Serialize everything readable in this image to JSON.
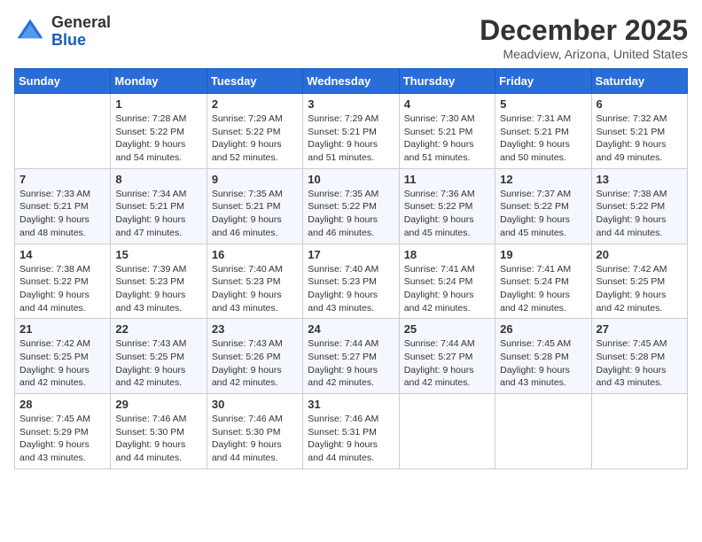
{
  "header": {
    "logo_general": "General",
    "logo_blue": "Blue",
    "month_year": "December 2025",
    "location": "Meadview, Arizona, United States"
  },
  "days_of_week": [
    "Sunday",
    "Monday",
    "Tuesday",
    "Wednesday",
    "Thursday",
    "Friday",
    "Saturday"
  ],
  "weeks": [
    [
      {
        "day": "",
        "info": ""
      },
      {
        "day": "1",
        "info": "Sunrise: 7:28 AM\nSunset: 5:22 PM\nDaylight: 9 hours\nand 54 minutes."
      },
      {
        "day": "2",
        "info": "Sunrise: 7:29 AM\nSunset: 5:22 PM\nDaylight: 9 hours\nand 52 minutes."
      },
      {
        "day": "3",
        "info": "Sunrise: 7:29 AM\nSunset: 5:21 PM\nDaylight: 9 hours\nand 51 minutes."
      },
      {
        "day": "4",
        "info": "Sunrise: 7:30 AM\nSunset: 5:21 PM\nDaylight: 9 hours\nand 51 minutes."
      },
      {
        "day": "5",
        "info": "Sunrise: 7:31 AM\nSunset: 5:21 PM\nDaylight: 9 hours\nand 50 minutes."
      },
      {
        "day": "6",
        "info": "Sunrise: 7:32 AM\nSunset: 5:21 PM\nDaylight: 9 hours\nand 49 minutes."
      }
    ],
    [
      {
        "day": "7",
        "info": "Sunrise: 7:33 AM\nSunset: 5:21 PM\nDaylight: 9 hours\nand 48 minutes."
      },
      {
        "day": "8",
        "info": "Sunrise: 7:34 AM\nSunset: 5:21 PM\nDaylight: 9 hours\nand 47 minutes."
      },
      {
        "day": "9",
        "info": "Sunrise: 7:35 AM\nSunset: 5:21 PM\nDaylight: 9 hours\nand 46 minutes."
      },
      {
        "day": "10",
        "info": "Sunrise: 7:35 AM\nSunset: 5:22 PM\nDaylight: 9 hours\nand 46 minutes."
      },
      {
        "day": "11",
        "info": "Sunrise: 7:36 AM\nSunset: 5:22 PM\nDaylight: 9 hours\nand 45 minutes."
      },
      {
        "day": "12",
        "info": "Sunrise: 7:37 AM\nSunset: 5:22 PM\nDaylight: 9 hours\nand 45 minutes."
      },
      {
        "day": "13",
        "info": "Sunrise: 7:38 AM\nSunset: 5:22 PM\nDaylight: 9 hours\nand 44 minutes."
      }
    ],
    [
      {
        "day": "14",
        "info": "Sunrise: 7:38 AM\nSunset: 5:22 PM\nDaylight: 9 hours\nand 44 minutes."
      },
      {
        "day": "15",
        "info": "Sunrise: 7:39 AM\nSunset: 5:23 PM\nDaylight: 9 hours\nand 43 minutes."
      },
      {
        "day": "16",
        "info": "Sunrise: 7:40 AM\nSunset: 5:23 PM\nDaylight: 9 hours\nand 43 minutes."
      },
      {
        "day": "17",
        "info": "Sunrise: 7:40 AM\nSunset: 5:23 PM\nDaylight: 9 hours\nand 43 minutes."
      },
      {
        "day": "18",
        "info": "Sunrise: 7:41 AM\nSunset: 5:24 PM\nDaylight: 9 hours\nand 42 minutes."
      },
      {
        "day": "19",
        "info": "Sunrise: 7:41 AM\nSunset: 5:24 PM\nDaylight: 9 hours\nand 42 minutes."
      },
      {
        "day": "20",
        "info": "Sunrise: 7:42 AM\nSunset: 5:25 PM\nDaylight: 9 hours\nand 42 minutes."
      }
    ],
    [
      {
        "day": "21",
        "info": "Sunrise: 7:42 AM\nSunset: 5:25 PM\nDaylight: 9 hours\nand 42 minutes."
      },
      {
        "day": "22",
        "info": "Sunrise: 7:43 AM\nSunset: 5:25 PM\nDaylight: 9 hours\nand 42 minutes."
      },
      {
        "day": "23",
        "info": "Sunrise: 7:43 AM\nSunset: 5:26 PM\nDaylight: 9 hours\nand 42 minutes."
      },
      {
        "day": "24",
        "info": "Sunrise: 7:44 AM\nSunset: 5:27 PM\nDaylight: 9 hours\nand 42 minutes."
      },
      {
        "day": "25",
        "info": "Sunrise: 7:44 AM\nSunset: 5:27 PM\nDaylight: 9 hours\nand 42 minutes."
      },
      {
        "day": "26",
        "info": "Sunrise: 7:45 AM\nSunset: 5:28 PM\nDaylight: 9 hours\nand 43 minutes."
      },
      {
        "day": "27",
        "info": "Sunrise: 7:45 AM\nSunset: 5:28 PM\nDaylight: 9 hours\nand 43 minutes."
      }
    ],
    [
      {
        "day": "28",
        "info": "Sunrise: 7:45 AM\nSunset: 5:29 PM\nDaylight: 9 hours\nand 43 minutes."
      },
      {
        "day": "29",
        "info": "Sunrise: 7:46 AM\nSunset: 5:30 PM\nDaylight: 9 hours\nand 44 minutes."
      },
      {
        "day": "30",
        "info": "Sunrise: 7:46 AM\nSunset: 5:30 PM\nDaylight: 9 hours\nand 44 minutes."
      },
      {
        "day": "31",
        "info": "Sunrise: 7:46 AM\nSunset: 5:31 PM\nDaylight: 9 hours\nand 44 minutes."
      },
      {
        "day": "",
        "info": ""
      },
      {
        "day": "",
        "info": ""
      },
      {
        "day": "",
        "info": ""
      }
    ]
  ]
}
